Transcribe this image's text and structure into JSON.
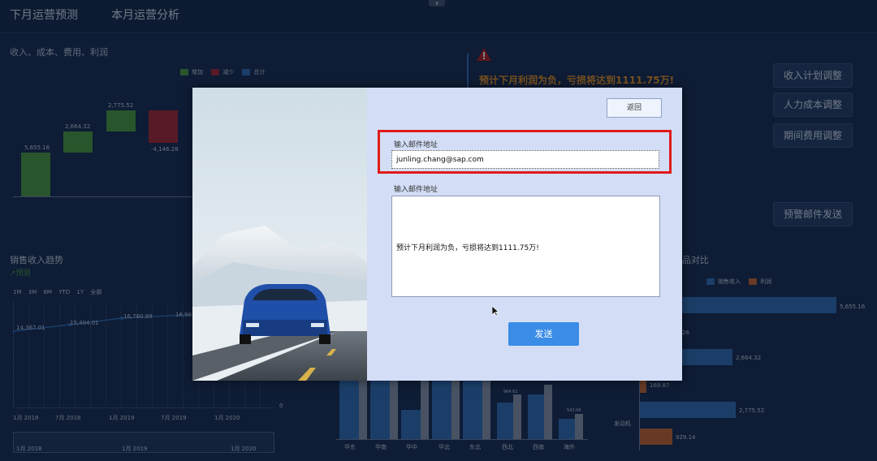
{
  "nav": {
    "tabs": [
      "下月运营预测",
      "本月运营分析"
    ]
  },
  "waterfall": {
    "title": "收入、成本、费用、利润",
    "legend": [
      "增加",
      "减少",
      "总计"
    ],
    "labels": [
      "5,655.16",
      "2,664.32",
      "2,775.52",
      "-4,146.28"
    ]
  },
  "alert": {
    "text": "预计下月利润为负，亏损将达到1111.75万!"
  },
  "actions": {
    "buttons": [
      "收入计划调整",
      "人力成本调整",
      "期间费用调整",
      "预警邮件发送"
    ]
  },
  "trend": {
    "title": "销售收入趋势",
    "subtitle": "预测",
    "ranges": [
      "1M",
      "3M",
      "6M",
      "YTD",
      "1Y",
      "全部"
    ],
    "point_labels": [
      "14,367.01",
      "15,404.01",
      "16,760.99",
      "16,98"
    ],
    "x_ticks": [
      "1月 2018",
      "7月 2018",
      "1月 2019",
      "7月 2019",
      "1月 2020"
    ],
    "nav_ticks": [
      "1月 2018",
      "1月 2019",
      "1月 2020"
    ],
    "zero_label": "0"
  },
  "regions": {
    "categories": [
      "华东",
      "华南",
      "华中",
      "华北",
      "东北",
      "西北",
      "西南",
      "海外"
    ],
    "labels": [
      "964.62",
      "543.06"
    ]
  },
  "products": {
    "title_fragment": "品对比",
    "legend": [
      "销售收入",
      "利润"
    ],
    "bar_labels": [
      "5,655.16",
      "26",
      "2,664.32",
      "169.87",
      "2,775.52",
      "929.14"
    ],
    "category_label": "发动机"
  },
  "colors": {
    "increase": "#4a9a3a",
    "decrease": "#a8252c",
    "total": "#2f6db3",
    "alert": "#e8921d",
    "revenue_bar": "#2f6db3",
    "profit_bar": "#c8642a"
  },
  "modal": {
    "back_label": "返回",
    "email_label": "输入邮件地址",
    "email_value": "junling.chang@sap.com",
    "message_label": "输入邮件地址",
    "message_value": "预计下月利润为负，亏损将达到1111.75万!",
    "send_label": "发送"
  }
}
